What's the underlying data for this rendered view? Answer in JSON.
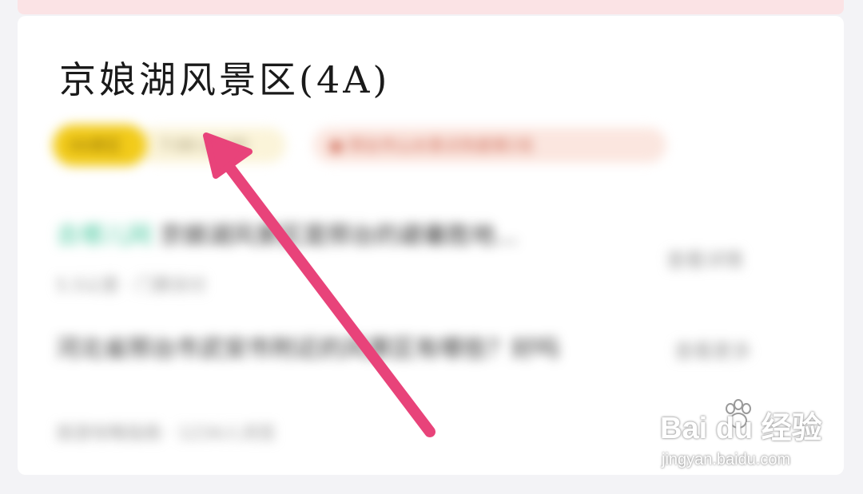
{
  "scenic": {
    "title": "京娘湖风景区(4A)",
    "tags": {
      "level": "4A景区",
      "open_time": "7:00-18:00",
      "ranking": "邢台市山水景点热度第2名"
    },
    "reviews": [
      {
        "highlight": "去哪儿网",
        "text": "京娘湖风景区是邢台的避暑胜地...",
        "meta": "5.5公里 · 门票另付",
        "side": "查看详情"
      },
      {
        "text": "河北省邢台市武安市附近的风景区有哪些？好吗",
        "meta": "旅游攻略指南 · 1234人浏览",
        "side": "查看更多"
      }
    ]
  },
  "watermark": {
    "brand": "Bai du 经验",
    "url": "jingyan.baidu.com"
  },
  "annotation": {
    "color": "#e8437a",
    "icon": "arrow-annotation"
  },
  "colors": {
    "tag_level": "#f2cb1a",
    "tag_open": "#fbf4d9",
    "tag_rank": "#fbe6df",
    "top_strip": "#fbe3e5",
    "accent": "#4cc9a0"
  }
}
